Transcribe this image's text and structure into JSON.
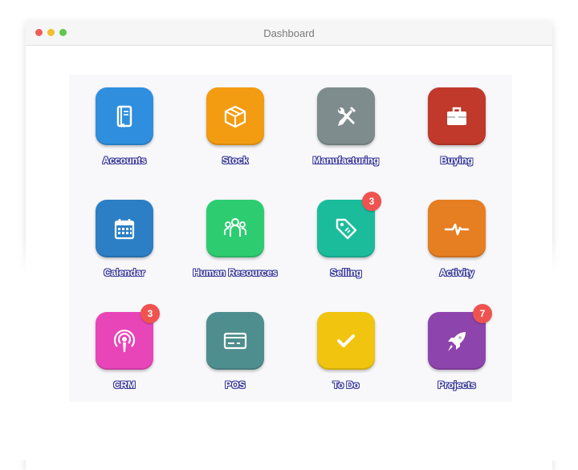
{
  "window": {
    "title": "Dashboard",
    "controls": [
      {
        "name": "close",
        "color": "#ec5f57"
      },
      {
        "name": "minimize",
        "color": "#f3be2f"
      },
      {
        "name": "maximize",
        "color": "#5fc84c"
      }
    ]
  },
  "apps": [
    {
      "label": "Accounts",
      "icon": "book-icon",
      "color": "#2f8fde",
      "badge": null
    },
    {
      "label": "Stock",
      "icon": "box-icon",
      "color": "#f39c12",
      "badge": null
    },
    {
      "label": "Manufacturing",
      "icon": "tools-icon",
      "color": "#7f8c8d",
      "badge": null
    },
    {
      "label": "Buying",
      "icon": "briefcase-icon",
      "color": "#c0392b",
      "badge": null
    },
    {
      "label": "Calendar",
      "icon": "calendar-icon",
      "color": "#2c7fc4",
      "badge": null
    },
    {
      "label": "Human Resources",
      "icon": "people-icon",
      "color": "#2ecc71",
      "badge": null
    },
    {
      "label": "Selling",
      "icon": "tag-icon",
      "color": "#1abc9c",
      "badge": "3"
    },
    {
      "label": "Activity",
      "icon": "pulse-icon",
      "color": "#e67e22",
      "badge": null
    },
    {
      "label": "CRM",
      "icon": "broadcast-icon",
      "color": "#e845b8",
      "badge": "3"
    },
    {
      "label": "POS",
      "icon": "card-icon",
      "color": "#4f8e8e",
      "badge": null
    },
    {
      "label": "To Do",
      "icon": "check-icon",
      "color": "#f1c40f",
      "badge": null
    },
    {
      "label": "Projects",
      "icon": "rocket-icon",
      "color": "#8e44ad",
      "badge": "7"
    }
  ]
}
